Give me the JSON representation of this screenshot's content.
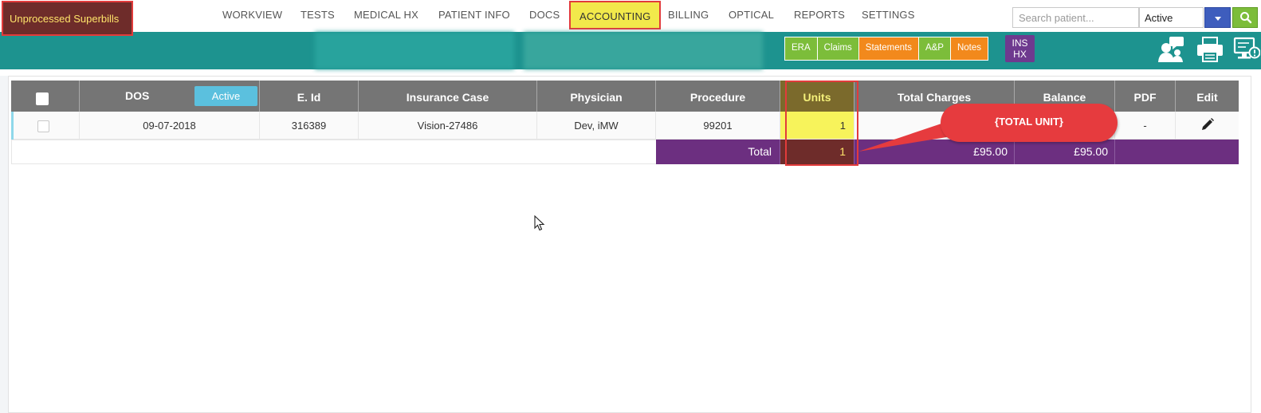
{
  "nav": {
    "items": [
      {
        "label": "WORKVIEW"
      },
      {
        "label": "TESTS"
      },
      {
        "label": "MEDICAL HX"
      },
      {
        "label": "PATIENT INFO"
      },
      {
        "label": "DOCS"
      },
      {
        "label": "ACCOUNTING",
        "active": true
      },
      {
        "label": "BILLING"
      },
      {
        "label": "OPTICAL"
      },
      {
        "label": "REPORTS"
      },
      {
        "label": "SETTINGS"
      }
    ],
    "search_placeholder": "Search patient...",
    "status_value": "Active"
  },
  "toolbar": {
    "superbills_label": "Unprocessed Superbills",
    "pills": [
      {
        "label": "ERA",
        "color": "#7cbd3a"
      },
      {
        "label": "Claims",
        "color": "#7cbd3a"
      },
      {
        "label": "Statements",
        "color": "#f2891c"
      },
      {
        "label": "A&P",
        "color": "#7cbd3a"
      },
      {
        "label": "Notes",
        "color": "#f2891c"
      }
    ],
    "ins_hx_line1": "INS",
    "ins_hx_line2": "HX",
    "icons": [
      "patient-chat-icon",
      "printer-icon",
      "monitor-alert-icon"
    ]
  },
  "table": {
    "columns": {
      "dos": "DOS",
      "active_badge": "Active",
      "eid": "E. Id",
      "insurance_case": "Insurance Case",
      "physician": "Physician",
      "procedure": "Procedure",
      "units": "Units",
      "total_charges": "Total Charges",
      "balance": "Balance",
      "pdf": "PDF",
      "edit": "Edit"
    },
    "rows": [
      {
        "dos": "09-07-2018",
        "eid": "316389",
        "insurance_case": "Vision-27486",
        "physician": "Dev, iMW",
        "procedure": "99201",
        "units": "1",
        "pdf": "-"
      }
    ],
    "total": {
      "label": "Total",
      "units": "1",
      "total_charges": "£95.00",
      "balance": "£95.00"
    }
  },
  "callout": {
    "text": "{TOTAL UNIT}"
  },
  "colors": {
    "teal": "#1d938f",
    "header_gray": "#757575",
    "total_purple": "#6c2f80",
    "highlight_yellow": "#f7f35b",
    "annotation_red": "#e23b3b"
  }
}
